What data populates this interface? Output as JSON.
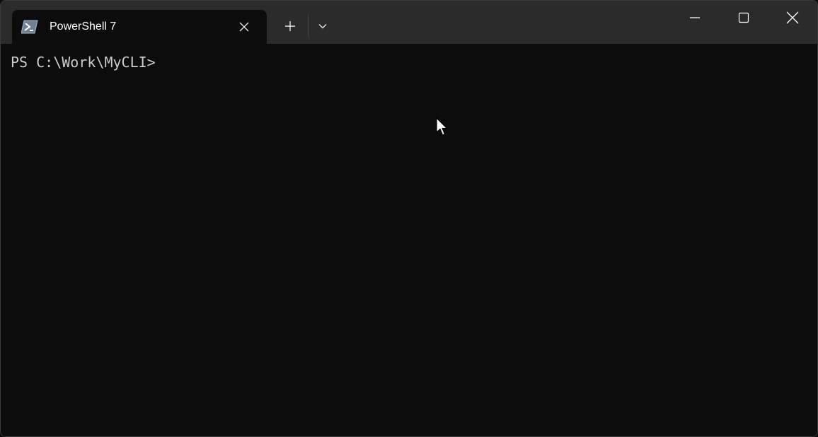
{
  "window": {
    "tab_title": "PowerShell 7"
  },
  "icons": {
    "tab_icon": "powershell-icon",
    "tab_close": "close-icon",
    "new_tab": "plus-icon",
    "dropdown": "chevron-down-icon",
    "minimize": "minimize-icon",
    "maximize": "maximize-icon",
    "close": "close-icon",
    "pointer": "mouse-pointer-icon"
  },
  "terminal": {
    "prompt": "PS C:\\Work\\MyCLI>"
  },
  "colors": {
    "titlebar_bg": "#2b2b2b",
    "terminal_bg": "#0c0c0c",
    "terminal_fg": "#cccccc",
    "tab_text": "#ffffff"
  }
}
